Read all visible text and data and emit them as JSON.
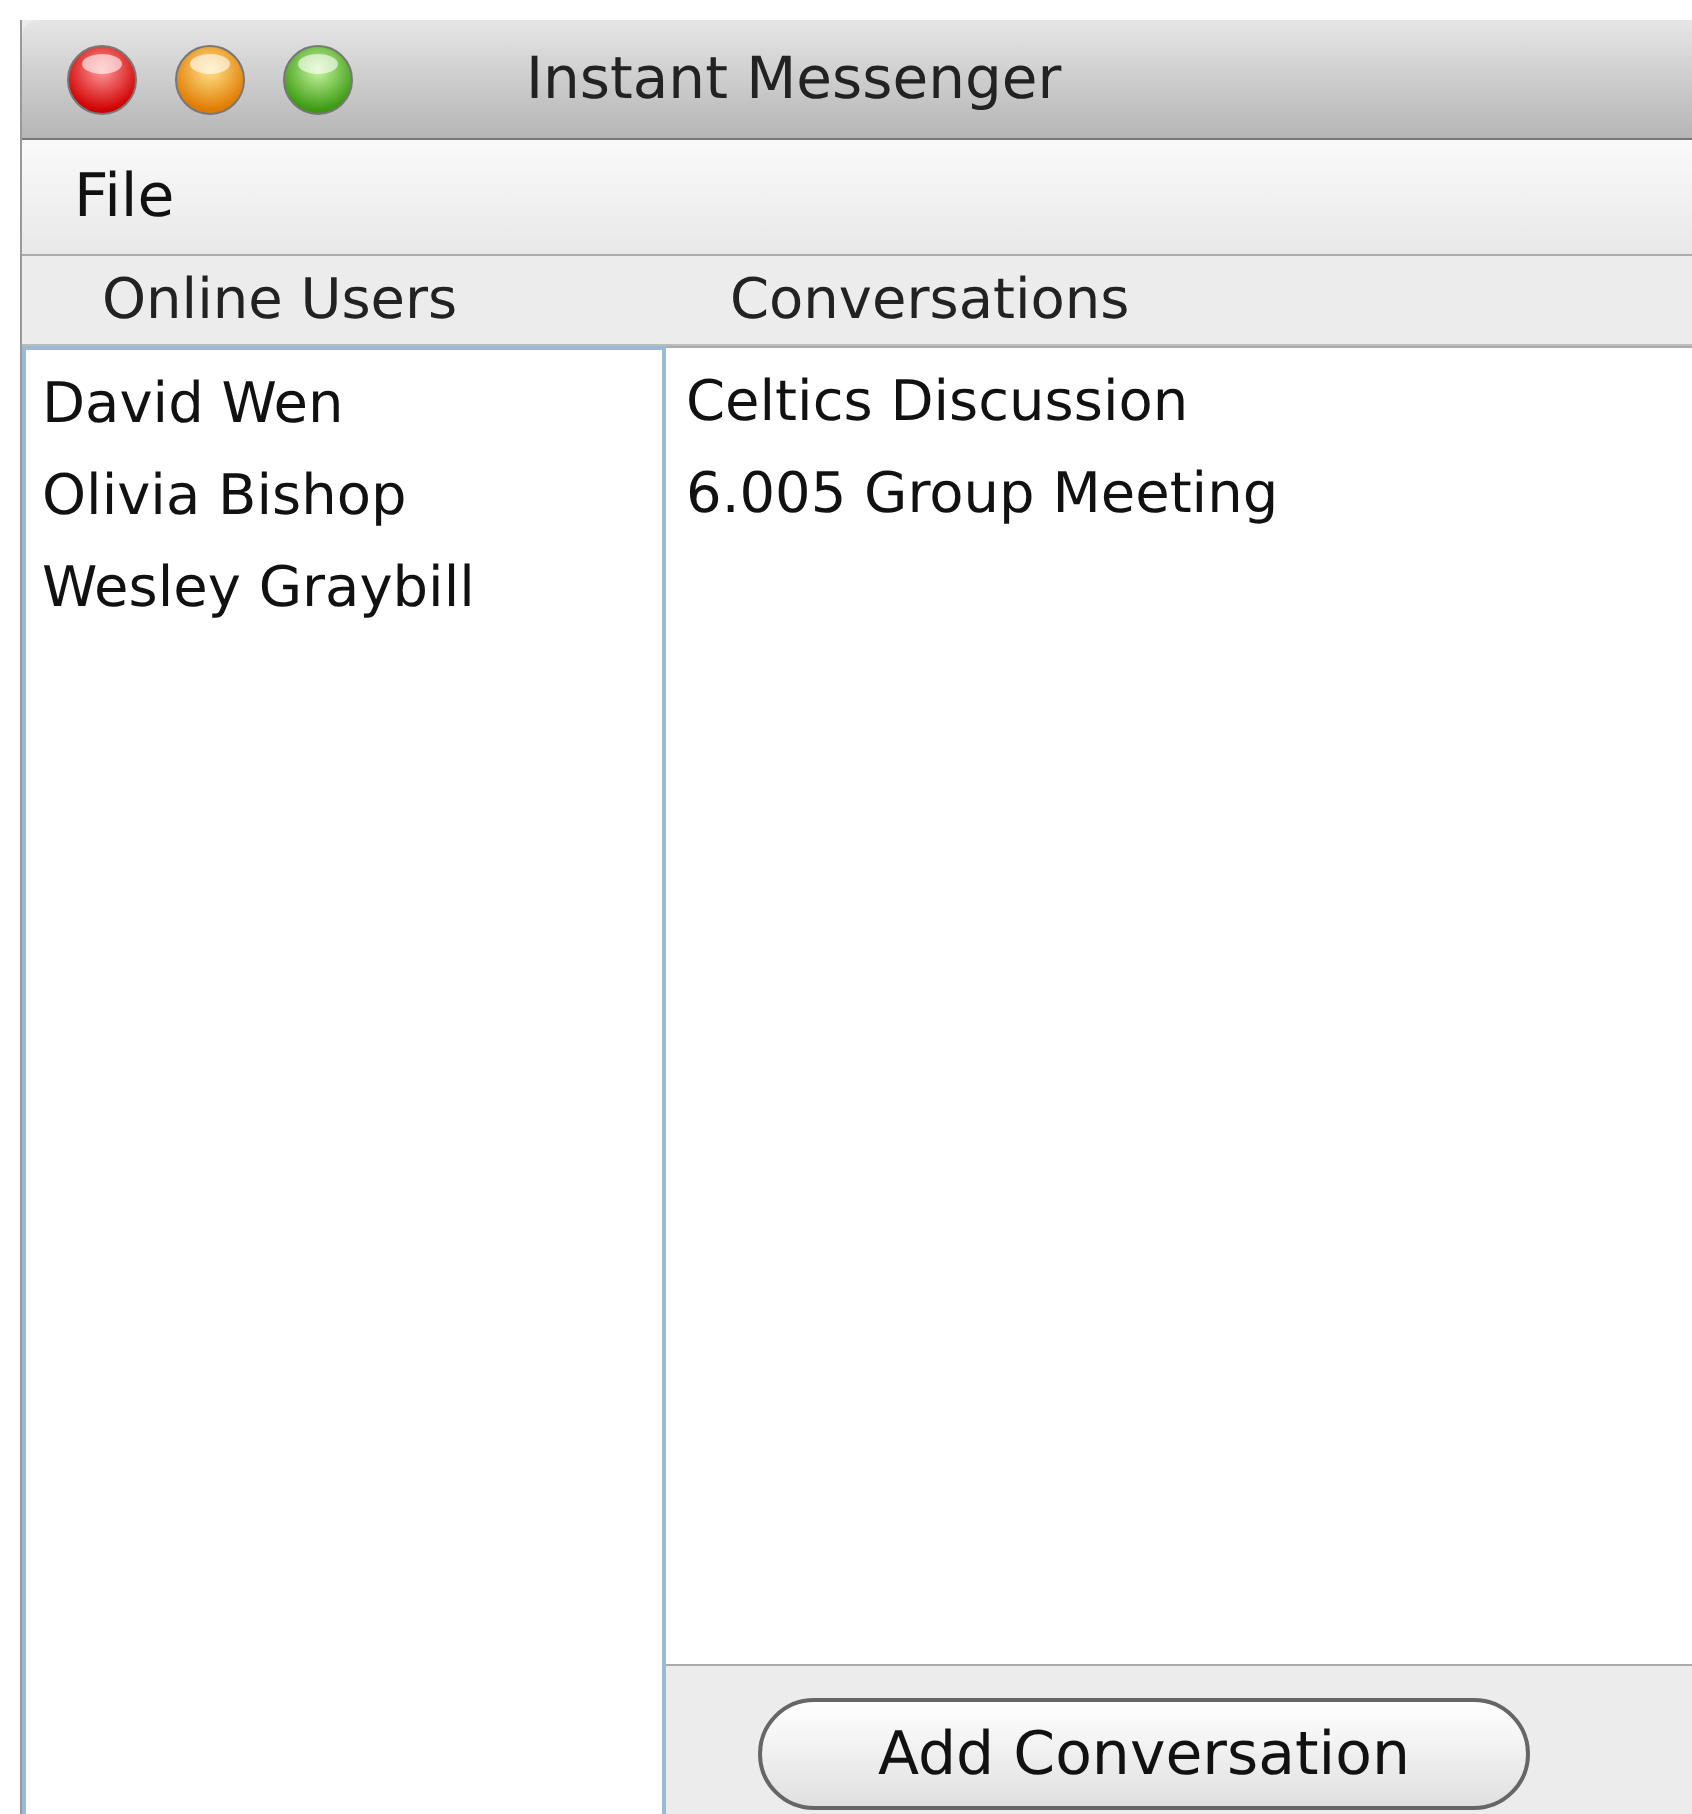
{
  "window": {
    "title": "Instant Messenger"
  },
  "menu": [
    "File"
  ],
  "columns": [
    "Online Users",
    "Conversations"
  ],
  "online_users": [
    "David Wen",
    "Olivia Bishop",
    "Wesley Graybill"
  ],
  "conversations": [
    "Celtics Discussion",
    "6.005 Group Meeting"
  ],
  "add_button": "Add Conversation"
}
